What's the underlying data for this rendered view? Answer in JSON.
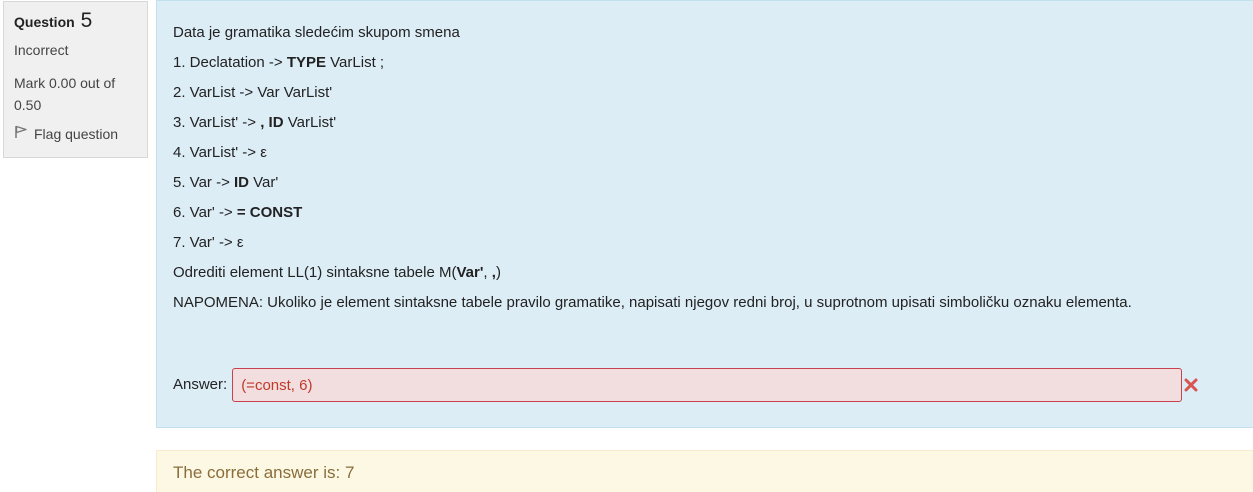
{
  "info": {
    "question_label": "Question",
    "question_number": "5",
    "state": "Incorrect",
    "grade": "Mark 0.00 out of 0.50",
    "flag_label": "Flag question",
    "flag_icon": "flag-icon"
  },
  "question": {
    "intro": "Data je gramatika sledećim skupom smena",
    "rules": [
      {
        "pre": "1. Declatation -> ",
        "bold": "TYPE",
        "post": " VarList ;"
      },
      {
        "pre": "2. VarList -> Var VarList'",
        "bold": "",
        "post": ""
      },
      {
        "pre": "3.  VarList' -> ",
        "bold": ",",
        "mid_space": " ",
        "bold2": "ID",
        "post": " VarList'"
      },
      {
        "pre": "4. VarList' -> ε",
        "bold": "",
        "post": ""
      },
      {
        "pre": "5. Var -> ",
        "bold": "ID",
        "post": " Var'"
      },
      {
        "pre": "6. Var' -> ",
        "bold": "= CONST",
        "post": ""
      },
      {
        "pre": "7.  Var' -> ε",
        "bold": "",
        "post": ""
      }
    ],
    "task_pre": "Odrediti element LL(1) sintaksne tabele M(",
    "task_bold1": "Var'",
    "task_mid": ", ",
    "task_bold2": ",",
    "task_post": ")",
    "note": "NAPOMENA: Ukoliko je element sintaksne tabele pravilo gramatike, napisati njegov redni broj, u suprotnom upisati simboličku oznaku elementa."
  },
  "answer": {
    "label": "Answer:",
    "value": "(=const, 6)",
    "status_icon": "incorrect-x-icon",
    "status_color": "#d9534f"
  },
  "feedback": {
    "right_answer": "The correct answer is: 7"
  },
  "colors": {
    "formulation_bg": "#dcedf6",
    "info_bg": "#f0f0f0",
    "answer_bg": "#f2dede",
    "feedback_bg": "#fcf8e3",
    "feedback_text": "#8a6d3b"
  }
}
